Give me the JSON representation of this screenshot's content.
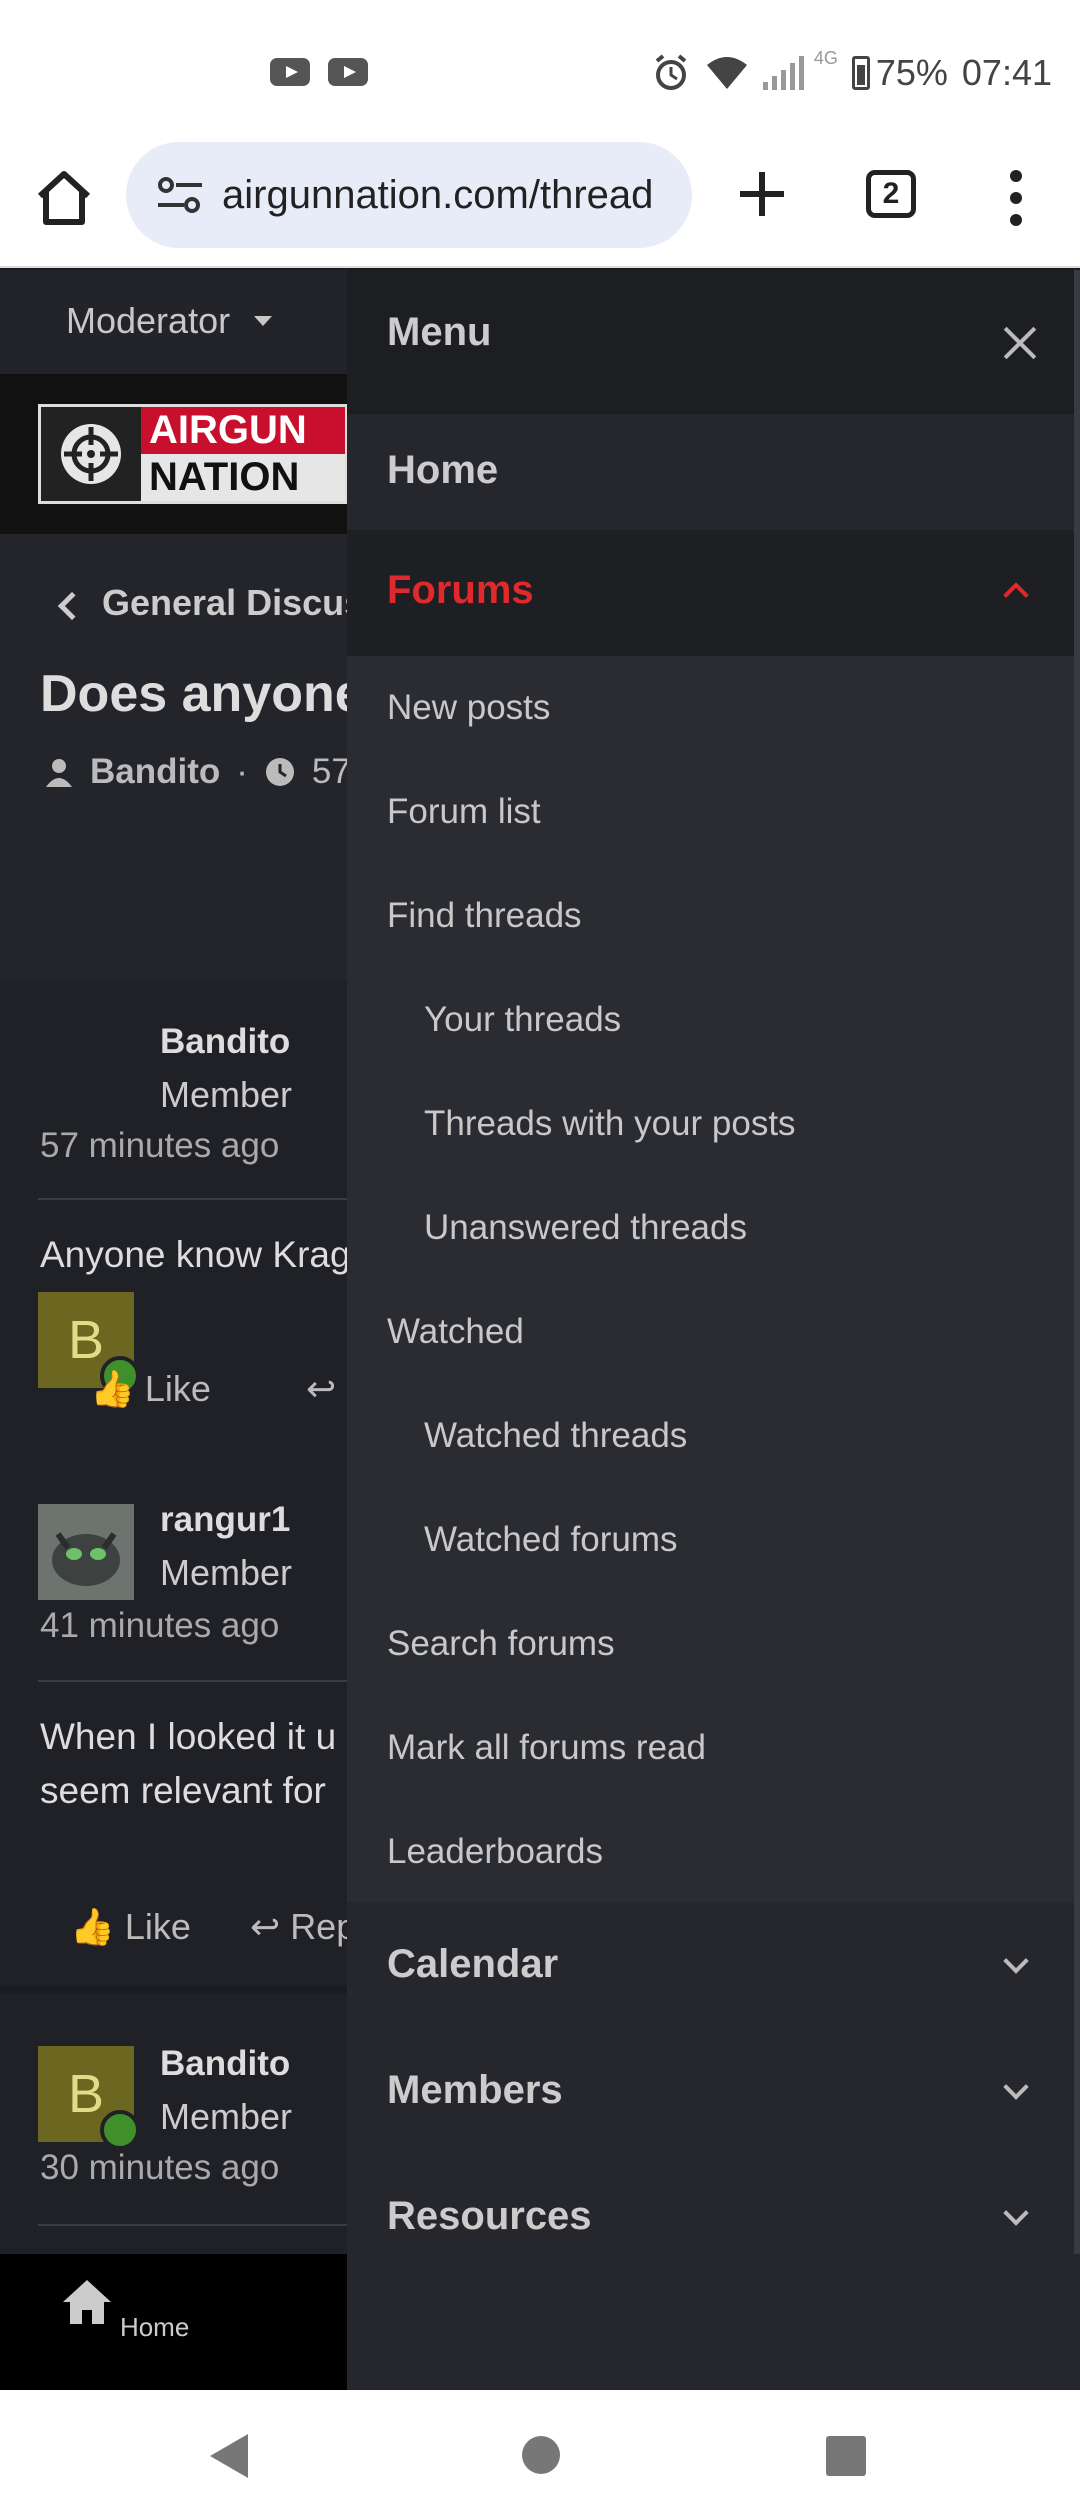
{
  "status_bar": {
    "battery": "75%",
    "time": "07:41",
    "network": "4G",
    "icons": [
      "youtube-icon",
      "youtube-icon",
      "alarm-icon",
      "wifi-icon",
      "signal-icon",
      "battery-icon"
    ]
  },
  "browser": {
    "url": "airgunnation.com/thread",
    "tab_count": "2"
  },
  "page": {
    "moderator_label": "Moderator",
    "logo_line1": "AIRGUN",
    "logo_line2": "NATION",
    "breadcrumb": "General Discus",
    "thread_title": "Does anyone",
    "thread_author": "Bandito",
    "thread_age": "57",
    "posts": [
      {
        "avatar_letter": "B",
        "name": "Bandito",
        "role": "Member",
        "time": "57 minutes ago",
        "body": [
          "Anyone know Krag"
        ],
        "like": "Like",
        "reply": ""
      },
      {
        "avatar_letter": "",
        "name": "rangur1",
        "role": "Member",
        "time": "41 minutes ago",
        "body": [
          "When I looked it u",
          "seem relevant for"
        ],
        "like": "Like",
        "reply": "Rep"
      },
      {
        "avatar_letter": "B",
        "name": "Bandito",
        "role": "Member",
        "time": "30 minutes ago",
        "body": [],
        "like": "",
        "reply": ""
      }
    ],
    "bottom_nav_home": "Home"
  },
  "menu": {
    "title": "Menu",
    "home": "Home",
    "forums": "Forums",
    "forum_items": [
      {
        "label": "New posts",
        "level": 1
      },
      {
        "label": "Forum list",
        "level": 1
      },
      {
        "label": "Find threads",
        "level": 1
      },
      {
        "label": "Your threads",
        "level": 2
      },
      {
        "label": "Threads with your posts",
        "level": 2
      },
      {
        "label": "Unanswered threads",
        "level": 2
      },
      {
        "label": "Watched",
        "level": 1
      },
      {
        "label": "Watched threads",
        "level": 2
      },
      {
        "label": "Watched forums",
        "level": 2
      },
      {
        "label": "Search forums",
        "level": 1
      },
      {
        "label": "Mark all forums read",
        "level": 1
      },
      {
        "label": "Leaderboards",
        "level": 1
      }
    ],
    "calendar": "Calendar",
    "members": "Members",
    "resources": "Resources"
  },
  "colors": {
    "accent_red": "#e0292d",
    "drawer_bg": "#2b2c31",
    "page_bg": "#1b1c21"
  }
}
